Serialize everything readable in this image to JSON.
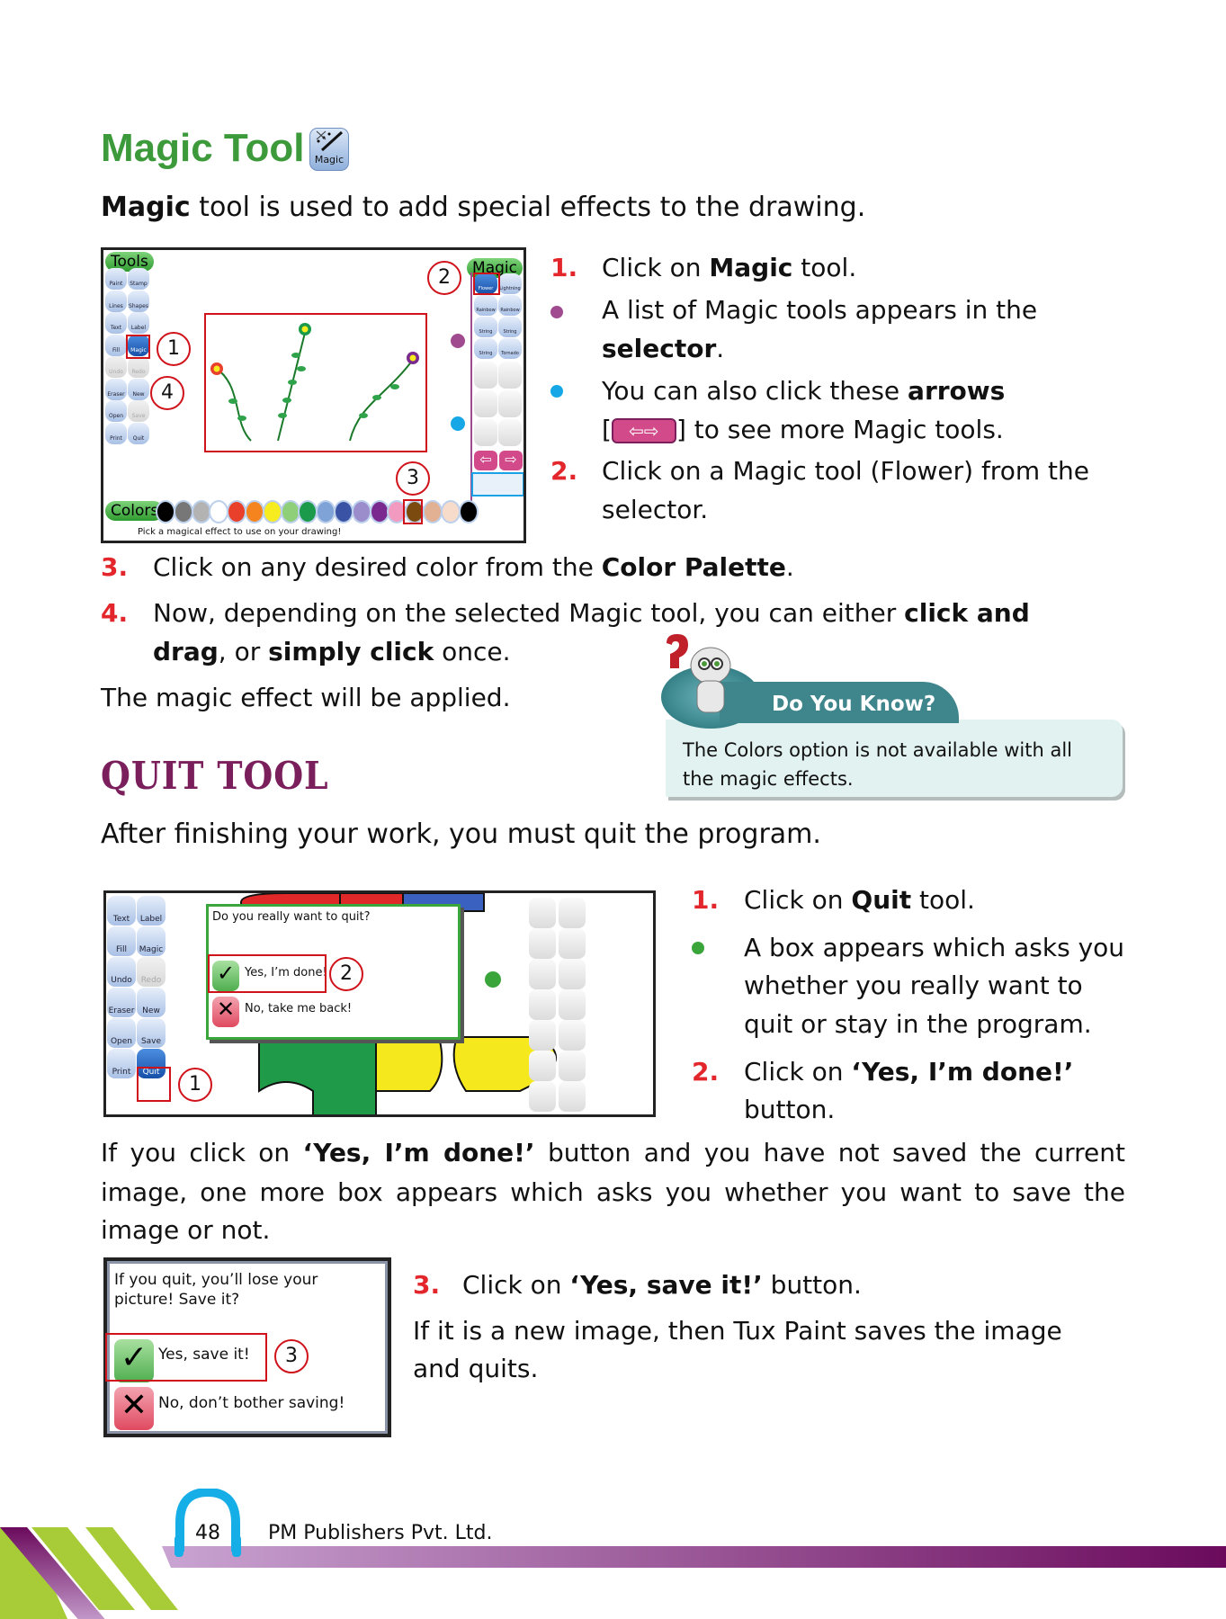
{
  "magic_section": {
    "title": "Magic Tool",
    "icon_label": "Magic",
    "intro_bold": "Magic",
    "intro_rest": " tool is used to add special effects to the drawing.",
    "screenshot": {
      "tools_header": "Tools",
      "magic_header": "Magic",
      "colors_header": "Colors",
      "tools": [
        "Paint",
        "Stamp",
        "Lines",
        "Shapes",
        "Text",
        "Label",
        "Fill",
        "Magic",
        "Undo",
        "Redo",
        "Eraser",
        "New",
        "Open",
        "Save",
        "Print",
        "Quit"
      ],
      "magic_items": [
        "Flower",
        "Lightning",
        "Rainbow",
        "Rainbow",
        "String",
        "String",
        "String",
        "Tornado"
      ],
      "status": "Pick a magical effect to use on your drawing!",
      "palette": [
        "#000000",
        "#777777",
        "#b3b3b3",
        "#ffffff",
        "#e8402a",
        "#f5841f",
        "#f7ec1f",
        "#8fcf7a",
        "#1a9a4a",
        "#7fa3d6",
        "#3a53a4",
        "#9b8ccc",
        "#7a2a8f",
        "#f29ac0",
        "#7a4a0f",
        "#e2b092",
        "#f8dccb",
        "#000000"
      ],
      "callouts": [
        "1",
        "2",
        "3",
        "4"
      ]
    },
    "steps": [
      {
        "marker": "1.",
        "pre": "Click on ",
        "bold": "Magic",
        "post": " tool."
      },
      {
        "marker": "bullet",
        "line1_pre": "A list of Magic tools appears in the",
        "line2_bold": "selector",
        "line2_post": "."
      },
      {
        "marker": "bullet",
        "line1_pre": "You can also click these ",
        "line1_bold": "arrows",
        "line2_pre": "[",
        "line2_post": "] to see more Magic tools."
      },
      {
        "marker": "2.",
        "line1": "Click on a Magic tool (Flower) from the",
        "line2": "selector."
      },
      {
        "marker": "3.",
        "pre": "Click on any desired color from the ",
        "bold": "Color Palette",
        "post": "."
      },
      {
        "marker": "4.",
        "line1_pre": "Now, depending on the selected Magic tool, you can either ",
        "line1_bold": "click and",
        "line2_bold1": "drag",
        "line2_mid": ", or ",
        "line2_bold2": "simply click",
        "line2_post": " once."
      }
    ],
    "result": "The magic effect will be applied.",
    "colors": {
      "bullet1": "#a04b8f",
      "bullet2": "#16a8e6"
    }
  },
  "do_you_know": {
    "title": "Do You Know?",
    "line1": "The Colors option is not available with all",
    "line2": "the magic effects."
  },
  "quit_section": {
    "title": "QUIT TOOL",
    "intro": "After finishing your work, you must quit the program.",
    "screenshot": {
      "tools": [
        "Text",
        "Label",
        "Fill",
        "Magic",
        "Undo",
        "Redo",
        "Eraser",
        "New",
        "Open",
        "Save",
        "Print",
        "Quit"
      ],
      "question": "Do you really want to quit?",
      "yes": "Yes, I’m done!",
      "no": "No, take me back!",
      "callouts": [
        "1",
        "2"
      ]
    },
    "steps": [
      {
        "marker": "1.",
        "pre": "Click on ",
        "bold": "Quit",
        "post": " tool."
      },
      {
        "marker": "bullet",
        "lines": [
          "A box appears which asks you",
          "whether you really want to",
          "quit or stay in the program."
        ]
      },
      {
        "marker": "2.",
        "pre": "Click on ",
        "bold": "‘Yes, I’m done!’",
        "line2": "button."
      }
    ],
    "para": {
      "l1_pre": "If you click on ",
      "l1_bold": "‘Yes, I’m done!’",
      "l1_post": " button and you have not saved the current",
      "l2": "image, one more box appears which asks you whether you want to save the",
      "l3": "image or not."
    },
    "save_dialog": {
      "question_l1": "If you quit, you’ll lose your",
      "question_l2": "picture! Save it?",
      "yes": "Yes, save it!",
      "no": "No, don’t bother saving!",
      "callout": "3"
    },
    "step3": {
      "marker": "3.",
      "pre": "Click on ",
      "bold": "‘Yes, save it!’",
      "post": " button."
    },
    "final": {
      "l1": "If it is a new image, then Tux Paint saves the image",
      "l2": "and quits."
    },
    "colors": {
      "bullet": "#3aa53a"
    }
  },
  "footer": {
    "page_number": "48",
    "publisher": "PM Publishers Pvt. Ltd."
  }
}
